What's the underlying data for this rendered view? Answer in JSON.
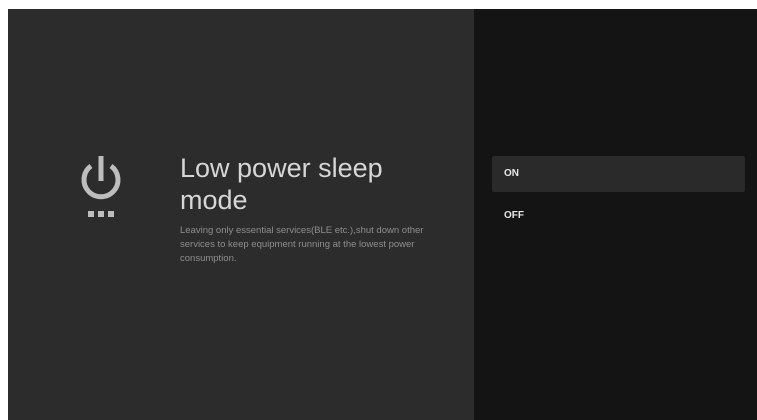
{
  "setting": {
    "icon": "power-standby-icon",
    "title": "Low power sleep mode",
    "description": "Leaving only essential services(BLE etc.),shut down other services to keep equipment running at the lowest power consumption."
  },
  "options": [
    {
      "label": "ON",
      "selected": true
    },
    {
      "label": "OFF",
      "selected": false
    }
  ],
  "colors": {
    "left_panel": "#2c2c2c",
    "right_panel": "#141414",
    "selected_option": "#2a2a2a",
    "title_text": "#d6d6d6",
    "description_text": "#8e8e8e",
    "icon": "#bdbdbd"
  }
}
